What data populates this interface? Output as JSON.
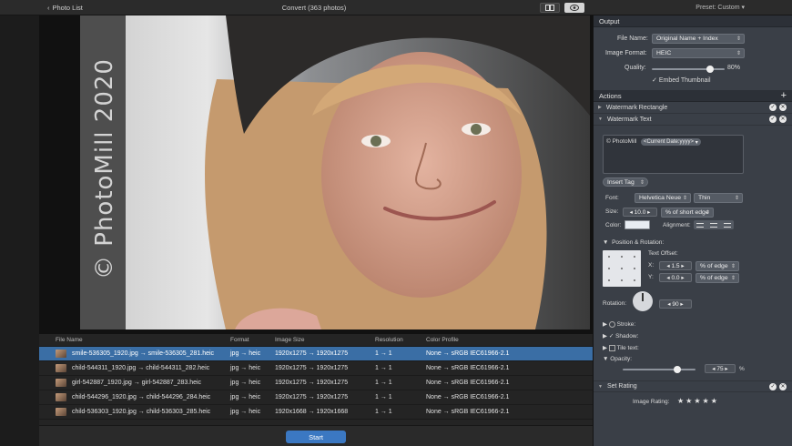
{
  "window": {
    "back_label": "Photo List",
    "title": "Convert (363 photos)",
    "preset": "Preset: Custom"
  },
  "preview": {
    "watermark_text": "© PhotoMill 2020"
  },
  "table": {
    "headers": [
      "File Name",
      "Format",
      "Image Size",
      "Resolution",
      "Color Profile"
    ],
    "rows": [
      {
        "name": "smile-536305_1920.jpg → smile-536305_281.heic",
        "format": "jpg → heic",
        "size": "1920x1275 → 1920x1275",
        "res": "1 → 1",
        "profile": "None → sRGB IEC61966-2.1"
      },
      {
        "name": "child-544311_1920.jpg → child-544311_282.heic",
        "format": "jpg → heic",
        "size": "1920x1275 → 1920x1275",
        "res": "1 → 1",
        "profile": "None → sRGB IEC61966-2.1"
      },
      {
        "name": "girl-542887_1920.jpg → girl-542887_283.heic",
        "format": "jpg → heic",
        "size": "1920x1275 → 1920x1275",
        "res": "1 → 1",
        "profile": "None → sRGB IEC61966-2.1"
      },
      {
        "name": "child-544296_1920.jpg → child-544296_284.heic",
        "format": "jpg → heic",
        "size": "1920x1275 → 1920x1275",
        "res": "1 → 1",
        "profile": "None → sRGB IEC61966-2.1"
      },
      {
        "name": "child-536303_1920.jpg → child-536303_285.heic",
        "format": "jpg → heic",
        "size": "1920x1668 → 1920x1668",
        "res": "1 → 1",
        "profile": "None → sRGB IEC61966-2.1"
      }
    ],
    "selected_row": 0
  },
  "start_label": "Start",
  "output": {
    "header": "Output",
    "file_name_label": "File Name:",
    "file_name_value": "Original Name + Index",
    "image_format_label": "Image Format:",
    "image_format_value": "HEIC",
    "quality_label": "Quality:",
    "quality_value": "80%",
    "quality_level": 0.8,
    "embed_thumbnail_label": "Embed Thumbnail"
  },
  "actions": {
    "header": "Actions",
    "add_icon": "plus-icon",
    "watermark_rectangle": "Watermark Rectangle",
    "watermark_text": "Watermark Text",
    "tag_prefix": "© PhotoMill",
    "tag_token": "<Current Date:yyyy>",
    "insert_tag": "Insert Tag",
    "font_label": "Font:",
    "font_value": "Helvetica Neue",
    "font_weight": "Thin",
    "size_label": "Size:",
    "size_value": "10.0",
    "size_unit": "% of short edge",
    "color_label": "Color:",
    "alignment_label": "Alignment:",
    "position_rotation": "Position & Rotation:",
    "text_offset": "Text Offset:",
    "x_label": "X:",
    "x_value": "1.5",
    "x_unit": "% of edge",
    "y_label": "Y:",
    "y_value": "0.0",
    "y_unit": "% of edge",
    "rotation_label": "Rotation:",
    "rotation_value": "90",
    "stroke_label": "Stroke:",
    "shadow_label": "Shadow:",
    "tile_text_label": "Tile text:",
    "opacity_label": "Opacity:",
    "opacity_value": "75",
    "opacity_unit": "%",
    "set_rating": "Set Rating",
    "image_rating_label": "Image Rating:",
    "stars": "★★★★★"
  }
}
